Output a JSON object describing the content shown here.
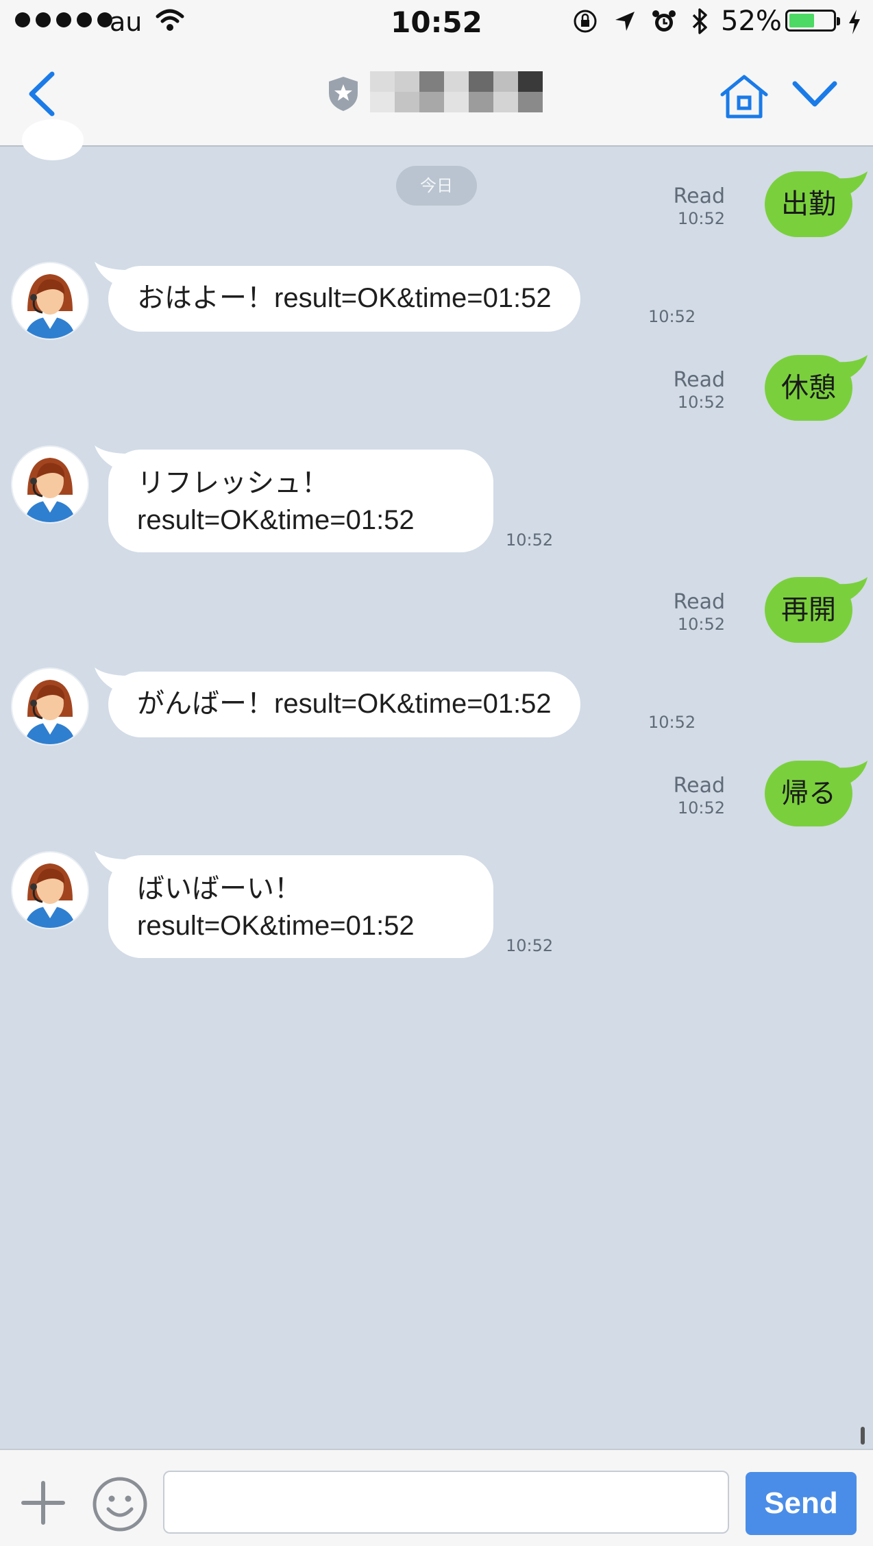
{
  "status_bar": {
    "carrier": "au",
    "time": "10:52",
    "battery_percent": "52%",
    "battery_level": 0.52,
    "icons": [
      "signal-dots-icon",
      "wifi-icon",
      "rotation-lock-icon",
      "location-arrow-icon",
      "alarm-icon",
      "bluetooth-icon",
      "battery-icon",
      "charging-bolt-icon"
    ]
  },
  "nav": {
    "back_icon": "chevron-left-icon",
    "title_icon": "shield-star-icon",
    "home_icon": "home-icon",
    "dropdown_icon": "chevron-down-icon"
  },
  "chat": {
    "date_separator": "今日",
    "messages": [
      {
        "side": "out",
        "text": "出勤",
        "read": "Read",
        "time": "10:52"
      },
      {
        "side": "in",
        "text": "おはよー！result=OK&time=01:52",
        "time": "10:52"
      },
      {
        "side": "out",
        "text": "休憩",
        "read": "Read",
        "time": "10:52"
      },
      {
        "side": "in",
        "line1": "リフレッシュ！",
        "line2": "result=OK&time=01:52",
        "time": "10:52"
      },
      {
        "side": "out",
        "text": "再開",
        "read": "Read",
        "time": "10:52"
      },
      {
        "side": "in",
        "text": "がんばー！result=OK&time=01:52",
        "time": "10:52"
      },
      {
        "side": "out",
        "text": "帰る",
        "read": "Read",
        "time": "10:52"
      },
      {
        "side": "in",
        "line1": "ばいばーい！",
        "line2": "result=OK&time=01:52",
        "time": "10:52"
      }
    ]
  },
  "input_bar": {
    "message_value": "",
    "send_label": "Send"
  },
  "colors": {
    "chat_background": "#d2dbe6",
    "outgoing_bubble": "#7ad03c",
    "incoming_bubble": "#ffffff",
    "accent": "#1a7be8",
    "send_button": "#4a8de8"
  }
}
